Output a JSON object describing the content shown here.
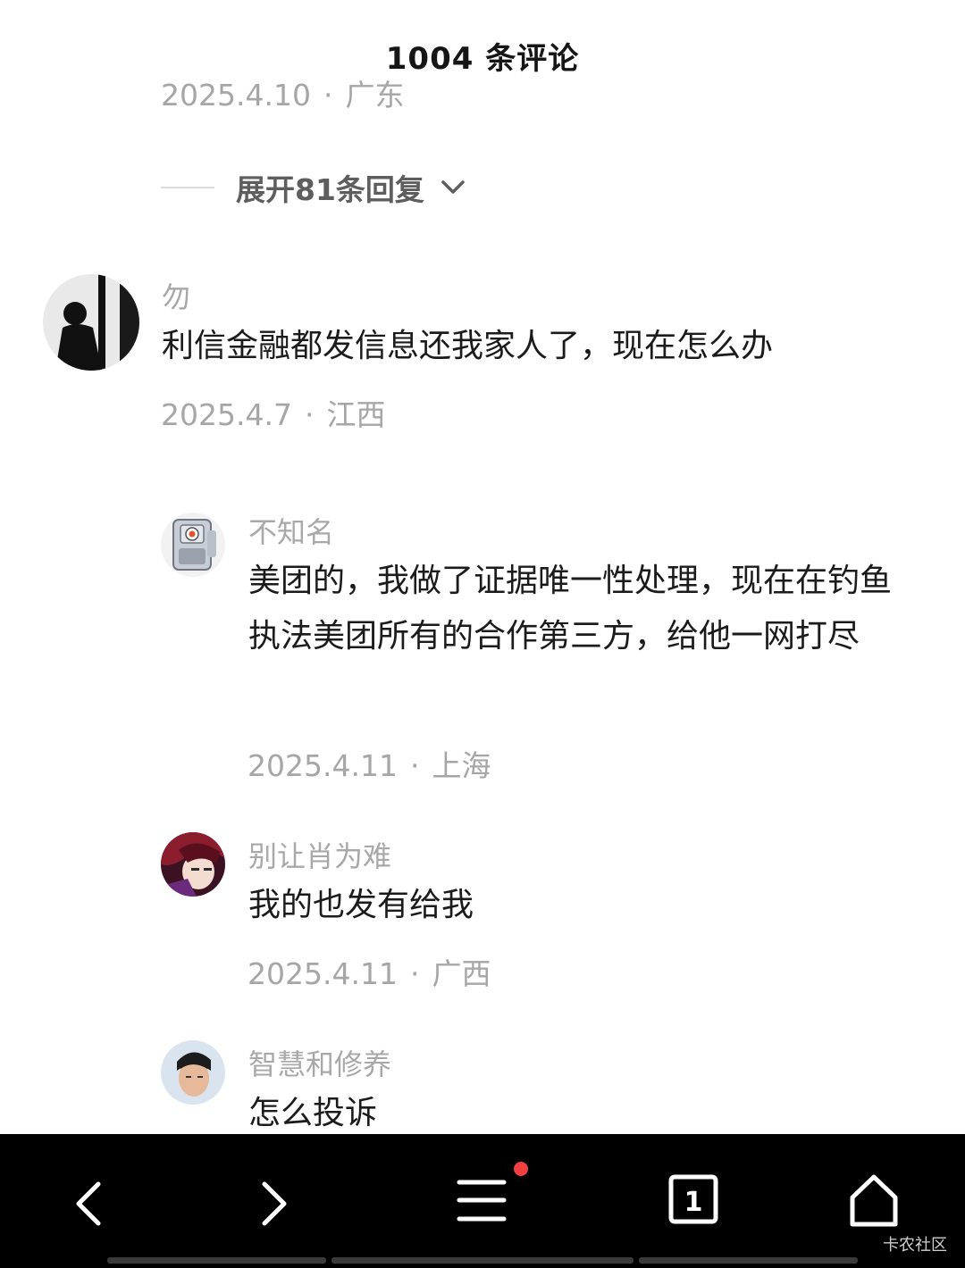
{
  "header": {
    "title": "1004 条评论"
  },
  "top_meta": {
    "date": "2025.4.10",
    "separator": "·",
    "location": "广东"
  },
  "expand": {
    "label": "展开81条回复"
  },
  "comments": [
    {
      "username": "勿",
      "content": "利信金融都发信息还我家人了，现在怎么办",
      "date": "2025.4.7",
      "location": "江西"
    }
  ],
  "replies": [
    {
      "username": "不知名",
      "content": "美团的，我做了证据唯一性处理，现在在钓鱼执法美团所有的合作第三方，给他一网打尽",
      "date": "2025.4.11",
      "location": "上海"
    },
    {
      "username": "别让肖为难",
      "content": "我的也发有给我",
      "date": "2025.4.11",
      "location": "广西"
    },
    {
      "username": "智慧和修养",
      "content": "怎么投诉"
    }
  ],
  "separator": "·",
  "navbar": {
    "tab_count": "1",
    "has_notification": true,
    "icons": [
      "back-icon",
      "forward-icon",
      "menu-icon",
      "tabs-icon",
      "home-icon"
    ]
  },
  "watermark": "卡农社区",
  "colors": {
    "navbar_bg": "#000000",
    "notification_dot": "#f23f3f",
    "meta_text": "#a6a6a6"
  }
}
